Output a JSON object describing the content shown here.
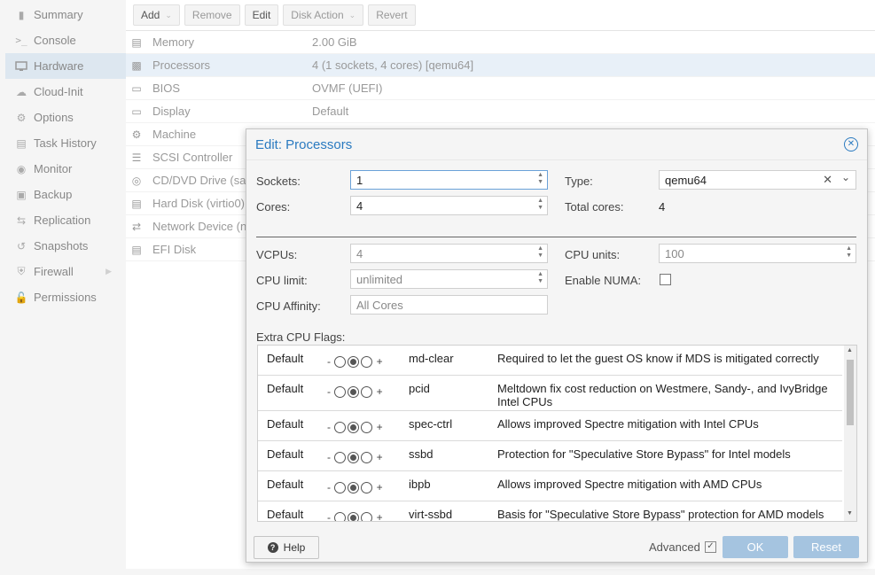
{
  "nav": {
    "items": [
      {
        "label": "Summary",
        "icon": "book-icon"
      },
      {
        "label": "Console",
        "icon": "terminal-icon"
      },
      {
        "label": "Hardware",
        "icon": "monitor-icon",
        "active": true
      },
      {
        "label": "Cloud-Init",
        "icon": "cloud-icon"
      },
      {
        "label": "Options",
        "icon": "gear-icon"
      },
      {
        "label": "Task History",
        "icon": "list-icon"
      },
      {
        "label": "Monitor",
        "icon": "eye-icon"
      },
      {
        "label": "Backup",
        "icon": "floppy-icon"
      },
      {
        "label": "Replication",
        "icon": "retweet-icon"
      },
      {
        "label": "Snapshots",
        "icon": "history-icon"
      },
      {
        "label": "Firewall",
        "icon": "shield-icon"
      },
      {
        "label": "Permissions",
        "icon": "unlock-icon"
      }
    ]
  },
  "toolbar": {
    "add": "Add",
    "remove": "Remove",
    "edit": "Edit",
    "disk_action": "Disk Action",
    "revert": "Revert"
  },
  "hardware": {
    "rows": [
      {
        "name": "Memory",
        "value": "2.00 GiB",
        "icon": "memory-icon"
      },
      {
        "name": "Processors",
        "value": "4 (1 sockets, 4 cores) [qemu64]",
        "icon": "cpu-icon",
        "selected": true
      },
      {
        "name": "BIOS",
        "value": "OVMF (UEFI)",
        "icon": "chip-icon"
      },
      {
        "name": "Display",
        "value": "Default",
        "icon": "desktop-icon"
      },
      {
        "name": "Machine",
        "value": "",
        "icon": "cogs-icon"
      },
      {
        "name": "SCSI Controller",
        "value": "",
        "icon": "database-icon"
      },
      {
        "name": "CD/DVD Drive (sa",
        "value": "",
        "icon": "disc-icon"
      },
      {
        "name": "Hard Disk (virtio0)",
        "value": "",
        "icon": "hdd-icon"
      },
      {
        "name": "Network Device (n",
        "value": "",
        "icon": "exchange-icon"
      },
      {
        "name": "EFI Disk",
        "value": "",
        "icon": "hdd-icon"
      }
    ]
  },
  "dialog": {
    "title": "Edit: Processors",
    "sockets_label": "Sockets:",
    "sockets_value": "1",
    "cores_label": "Cores:",
    "cores_value": "4",
    "type_label": "Type:",
    "type_value": "qemu64",
    "total_cores_label": "Total cores:",
    "total_cores_value": "4",
    "vcpus_label": "VCPUs:",
    "vcpus_value": "4",
    "cpu_units_label": "CPU units:",
    "cpu_units_value": "100",
    "cpu_limit_label": "CPU limit:",
    "cpu_limit_value": "unlimited",
    "enable_numa_label": "Enable NUMA:",
    "cpu_affinity_label": "CPU Affinity:",
    "cpu_affinity_placeholder": "All Cores",
    "extra_flags_label": "Extra CPU Flags:",
    "flags": [
      {
        "state": "Default",
        "name": "md-clear",
        "desc": "Required to let the guest OS know if MDS is mitigated correctly"
      },
      {
        "state": "Default",
        "name": "pcid",
        "desc": "Meltdown fix cost reduction on Westmere, Sandy-, and IvyBridge Intel CPUs"
      },
      {
        "state": "Default",
        "name": "spec-ctrl",
        "desc": "Allows improved Spectre mitigation with Intel CPUs"
      },
      {
        "state": "Default",
        "name": "ssbd",
        "desc": "Protection for \"Speculative Store Bypass\" for Intel models"
      },
      {
        "state": "Default",
        "name": "ibpb",
        "desc": "Allows improved Spectre mitigation with AMD CPUs"
      },
      {
        "state": "Default",
        "name": "virt-ssbd",
        "desc": "Basis for \"Speculative Store Bypass\" protection for AMD models"
      }
    ],
    "help": "Help",
    "advanced": "Advanced",
    "ok": "OK",
    "reset": "Reset"
  }
}
